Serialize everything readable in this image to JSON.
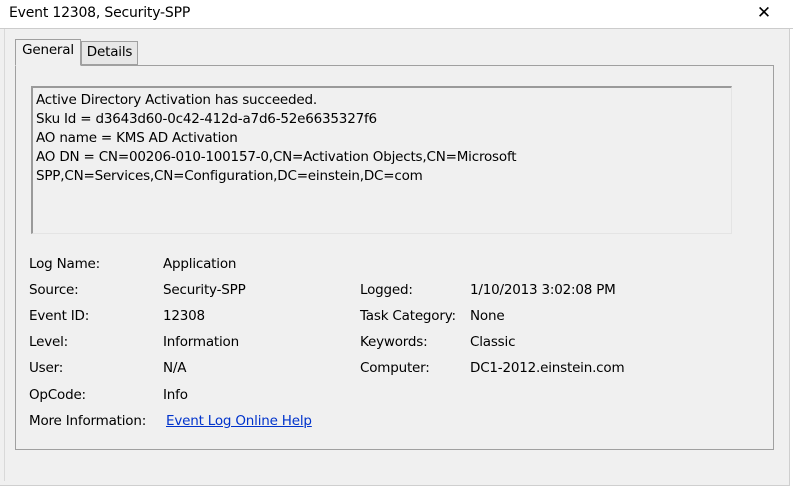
{
  "window": {
    "title": "Event 12308, Security-SPP",
    "close_glyph": "✕"
  },
  "tabs": [
    {
      "label": "General",
      "selected": true
    },
    {
      "label": "Details",
      "selected": false
    }
  ],
  "message": {
    "lines": [
      "Active Directory Activation has succeeded.",
      "Sku Id = d3643d60-0c42-412d-a7d6-52e6635327f6",
      "AO name = KMS AD Activation",
      "AO DN = CN=00206-010-100157-0,CN=Activation Objects,CN=Microsoft",
      "SPP,CN=Services,CN=Configuration,DC=einstein,DC=com"
    ]
  },
  "details": {
    "log_name": {
      "label": "Log Name:",
      "value": "Application"
    },
    "source": {
      "label": "Source:",
      "value": "Security-SPP"
    },
    "event_id": {
      "label": "Event ID:",
      "value": "12308"
    },
    "level": {
      "label": "Level:",
      "value": "Information"
    },
    "user": {
      "label": "User:",
      "value": "N/A"
    },
    "opcode": {
      "label": "OpCode:",
      "value": "Info"
    },
    "more_info": {
      "label": "More Information:",
      "link": "Event Log Online Help"
    },
    "logged": {
      "label": "Logged:",
      "value": "1/10/2013 3:02:08 PM"
    },
    "task_category": {
      "label": "Task Category:",
      "value": "None"
    },
    "keywords": {
      "label": "Keywords:",
      "value": "Classic"
    },
    "computer": {
      "label": "Computer:",
      "value": "DC1-2012.einstein.com"
    }
  },
  "colors": {
    "link": "#0033cc",
    "panel_bg": "#f0f0f0",
    "border": "#a0a0a0"
  }
}
